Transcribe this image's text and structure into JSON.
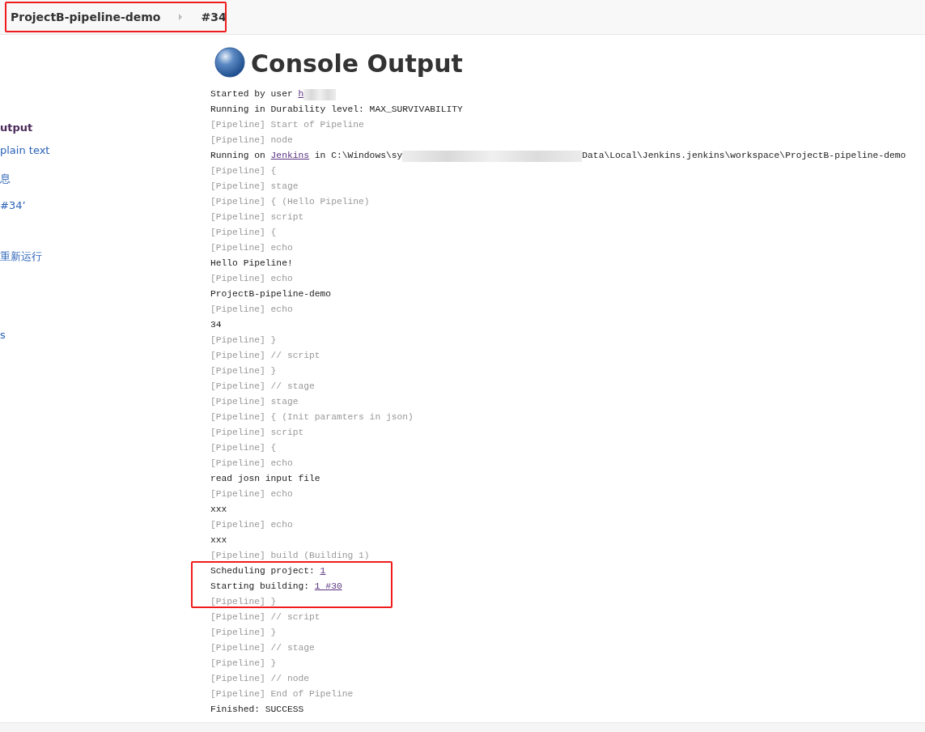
{
  "breadcrumb": [
    {
      "label": "ProjectB-pipeline-demo"
    },
    {
      "label": "#34"
    }
  ],
  "sidebar": {
    "items": [
      {
        "label": "utput",
        "selected": true
      },
      {
        "label": "plain text",
        "selected": false
      },
      {
        "label": "息",
        "selected": false
      },
      {
        "label": "#34’",
        "selected": false
      },
      {
        "label": "重新运行",
        "selected": false
      },
      {
        "label": "s",
        "selected": false
      }
    ]
  },
  "title": "Console Output",
  "console": [
    {
      "kind": "output",
      "parts": [
        {
          "kind": "text",
          "text": "Started by user "
        },
        {
          "kind": "link",
          "text": "h"
        },
        {
          "kind": "redacted"
        }
      ]
    },
    {
      "kind": "output",
      "parts": [
        {
          "kind": "text",
          "text": "Running in Durability level: MAX_SURVIVABILITY"
        }
      ]
    },
    {
      "kind": "pipeline",
      "parts": [
        {
          "kind": "text",
          "text": "[Pipeline] Start of Pipeline"
        }
      ]
    },
    {
      "kind": "pipeline",
      "parts": [
        {
          "kind": "text",
          "text": "[Pipeline] node"
        }
      ]
    },
    {
      "kind": "output",
      "parts": [
        {
          "kind": "text",
          "text": "Running on "
        },
        {
          "kind": "link",
          "text": "Jenkins"
        },
        {
          "kind": "text",
          "text": " in C:\\Windows\\sy"
        },
        {
          "kind": "redacted"
        },
        {
          "kind": "text",
          "text": "Data\\Local\\Jenkins.jenkins\\workspace\\ProjectB-pipeline-demo"
        }
      ]
    },
    {
      "kind": "pipeline",
      "parts": [
        {
          "kind": "text",
          "text": "[Pipeline] {"
        }
      ]
    },
    {
      "kind": "pipeline",
      "parts": [
        {
          "kind": "text",
          "text": "[Pipeline] stage"
        }
      ]
    },
    {
      "kind": "pipeline",
      "parts": [
        {
          "kind": "text",
          "text": "[Pipeline] { (Hello Pipeline)"
        }
      ]
    },
    {
      "kind": "pipeline",
      "parts": [
        {
          "kind": "text",
          "text": "[Pipeline] script"
        }
      ]
    },
    {
      "kind": "pipeline",
      "parts": [
        {
          "kind": "text",
          "text": "[Pipeline] {"
        }
      ]
    },
    {
      "kind": "pipeline",
      "parts": [
        {
          "kind": "text",
          "text": "[Pipeline] echo"
        }
      ]
    },
    {
      "kind": "output",
      "parts": [
        {
          "kind": "text",
          "text": "Hello Pipeline!"
        }
      ]
    },
    {
      "kind": "pipeline",
      "parts": [
        {
          "kind": "text",
          "text": "[Pipeline] echo"
        }
      ]
    },
    {
      "kind": "output",
      "parts": [
        {
          "kind": "text",
          "text": "ProjectB-pipeline-demo"
        }
      ]
    },
    {
      "kind": "pipeline",
      "parts": [
        {
          "kind": "text",
          "text": "[Pipeline] echo"
        }
      ]
    },
    {
      "kind": "output",
      "parts": [
        {
          "kind": "text",
          "text": "34"
        }
      ]
    },
    {
      "kind": "pipeline",
      "parts": [
        {
          "kind": "text",
          "text": "[Pipeline] }"
        }
      ]
    },
    {
      "kind": "pipeline",
      "parts": [
        {
          "kind": "text",
          "text": "[Pipeline] // script"
        }
      ]
    },
    {
      "kind": "pipeline",
      "parts": [
        {
          "kind": "text",
          "text": "[Pipeline] }"
        }
      ]
    },
    {
      "kind": "pipeline",
      "parts": [
        {
          "kind": "text",
          "text": "[Pipeline] // stage"
        }
      ]
    },
    {
      "kind": "pipeline",
      "parts": [
        {
          "kind": "text",
          "text": "[Pipeline] stage"
        }
      ]
    },
    {
      "kind": "pipeline",
      "parts": [
        {
          "kind": "text",
          "text": "[Pipeline] { (Init paramters in json)"
        }
      ]
    },
    {
      "kind": "pipeline",
      "parts": [
        {
          "kind": "text",
          "text": "[Pipeline] script"
        }
      ]
    },
    {
      "kind": "pipeline",
      "parts": [
        {
          "kind": "text",
          "text": "[Pipeline] {"
        }
      ]
    },
    {
      "kind": "pipeline",
      "parts": [
        {
          "kind": "text",
          "text": "[Pipeline] echo"
        }
      ]
    },
    {
      "kind": "output",
      "parts": [
        {
          "kind": "text",
          "text": "read josn input file"
        }
      ]
    },
    {
      "kind": "pipeline",
      "parts": [
        {
          "kind": "text",
          "text": "[Pipeline] echo"
        }
      ]
    },
    {
      "kind": "output",
      "parts": [
        {
          "kind": "text",
          "text": "xxx"
        }
      ]
    },
    {
      "kind": "pipeline",
      "parts": [
        {
          "kind": "text",
          "text": "[Pipeline] echo"
        }
      ]
    },
    {
      "kind": "output",
      "parts": [
        {
          "kind": "text",
          "text": "xxx"
        }
      ]
    },
    {
      "kind": "pipeline",
      "parts": [
        {
          "kind": "text",
          "text": "[Pipeline] build (Building 1)"
        }
      ]
    },
    {
      "kind": "output",
      "parts": [
        {
          "kind": "text",
          "text": "Scheduling project: "
        },
        {
          "kind": "link",
          "text": "1"
        }
      ]
    },
    {
      "kind": "output",
      "parts": [
        {
          "kind": "text",
          "text": "Starting building: "
        },
        {
          "kind": "link",
          "text": "1 #30"
        }
      ]
    },
    {
      "kind": "pipeline",
      "parts": [
        {
          "kind": "text",
          "text": "[Pipeline] }"
        }
      ]
    },
    {
      "kind": "pipeline",
      "parts": [
        {
          "kind": "text",
          "text": "[Pipeline] // script"
        }
      ]
    },
    {
      "kind": "pipeline",
      "parts": [
        {
          "kind": "text",
          "text": "[Pipeline] }"
        }
      ]
    },
    {
      "kind": "pipeline",
      "parts": [
        {
          "kind": "text",
          "text": "[Pipeline] // stage"
        }
      ]
    },
    {
      "kind": "pipeline",
      "parts": [
        {
          "kind": "text",
          "text": "[Pipeline] }"
        }
      ]
    },
    {
      "kind": "pipeline",
      "parts": [
        {
          "kind": "text",
          "text": "[Pipeline] // node"
        }
      ]
    },
    {
      "kind": "pipeline",
      "parts": [
        {
          "kind": "text",
          "text": "[Pipeline] End of Pipeline"
        }
      ]
    },
    {
      "kind": "output",
      "parts": [
        {
          "kind": "text",
          "text": "Finished: SUCCESS"
        }
      ]
    }
  ]
}
